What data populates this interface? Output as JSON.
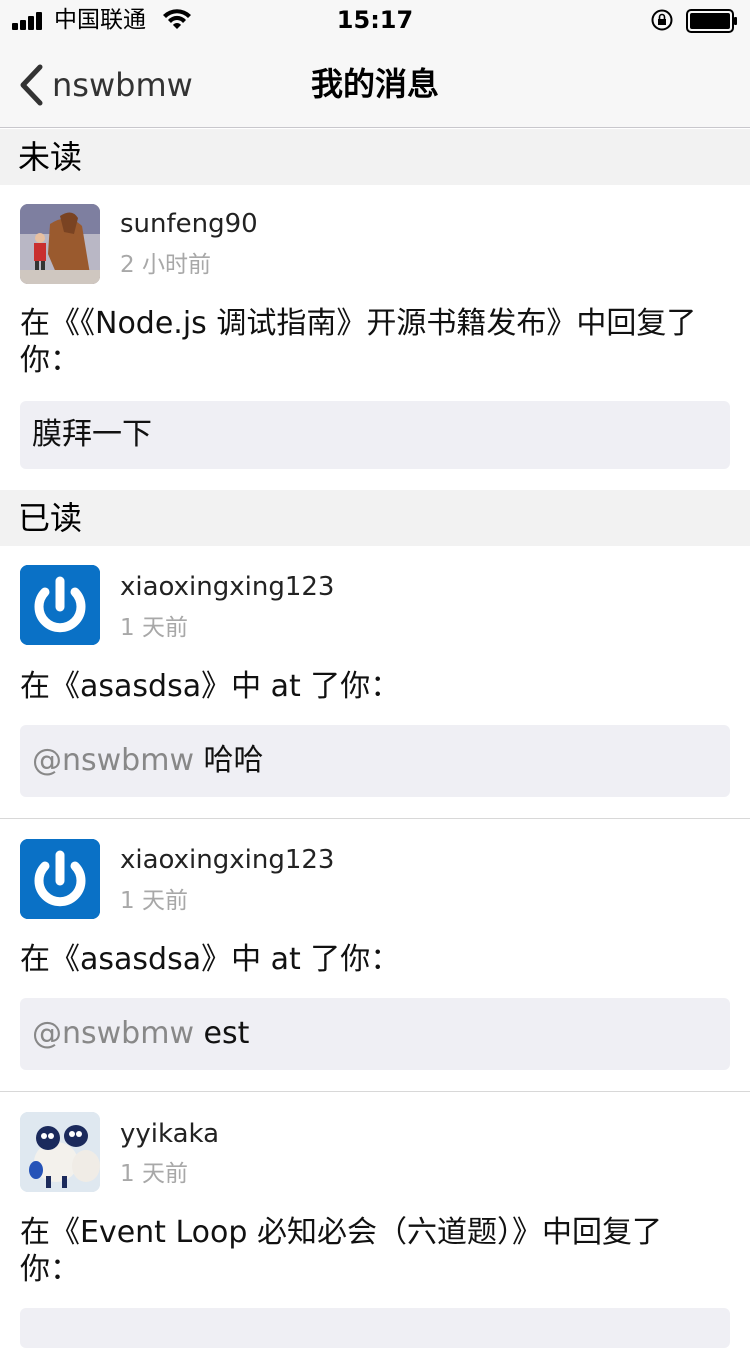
{
  "status_bar": {
    "carrier": "中国联通",
    "time": "15:17"
  },
  "nav": {
    "back_label": "nswbmw",
    "title": "我的消息"
  },
  "sections": {
    "unread": "未读",
    "read": "已读"
  },
  "messages": [
    {
      "username": "sunfeng90",
      "time": "2 小时前",
      "text": "在《《Node.js 调试指南》开源书籍发布》中回复了你：",
      "quote_mention": "",
      "quote_text": "膜拜一下"
    },
    {
      "username": "xiaoxingxing123",
      "time": "1 天前",
      "text": "在《asasdsa》中 at 了你：",
      "quote_mention": "@nswbmw",
      "quote_text": " 哈哈"
    },
    {
      "username": "xiaoxingxing123",
      "time": "1 天前",
      "text": "在《asasdsa》中 at 了你：",
      "quote_mention": "@nswbmw",
      "quote_text": " est"
    },
    {
      "username": "yyikaka",
      "time": "1 天前",
      "text": "在《Event Loop 必知必会（六道题）》中回复了你：",
      "quote_mention": "",
      "quote_text": ""
    }
  ],
  "colors": {
    "bar_bg": "#f7f7f7",
    "section_bg": "#f2f2f2",
    "quote_bg": "#efeff4",
    "power_avatar": "#0a71c6"
  }
}
